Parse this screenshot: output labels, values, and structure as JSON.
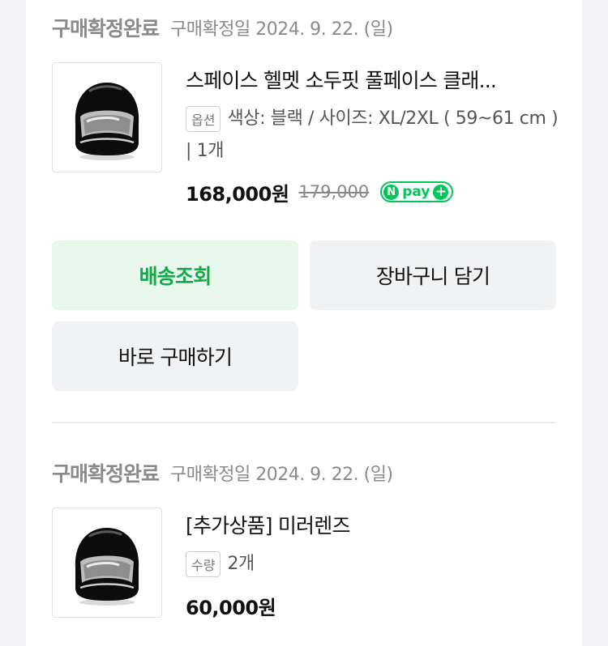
{
  "orders": [
    {
      "status": "구매확정완료",
      "date_text": "구매확정일 2024. 9. 22. (일)",
      "product_image": "black-fullface-helmet",
      "title": "스페이스 헬멧 소두핏 풀페이스 클래...",
      "option_badge": "옵션",
      "option_text": "색상: 블랙 / 사이즈: XL/2XL ( 59~61 cm ) | 1개",
      "price": "168,000원",
      "original_price": "179,000",
      "npay": {
        "n": "N",
        "label": "pay",
        "plus": "+"
      },
      "buttons": {
        "track_delivery": "배송조회",
        "add_to_cart": "장바구니 담기",
        "buy_now": "바로 구매하기"
      }
    },
    {
      "status": "구매확정완료",
      "date_text": "구매확정일 2024. 9. 22. (일)",
      "product_image": "black-fullface-helmet",
      "title": "[추가상품] 미러렌즈",
      "option_badge": "수량",
      "option_text": "2개",
      "price": "60,000원"
    }
  ],
  "colors": {
    "accent_green": "#03c75a",
    "button_green_bg": "#e8f8ec",
    "button_green_text": "#12a84b"
  }
}
